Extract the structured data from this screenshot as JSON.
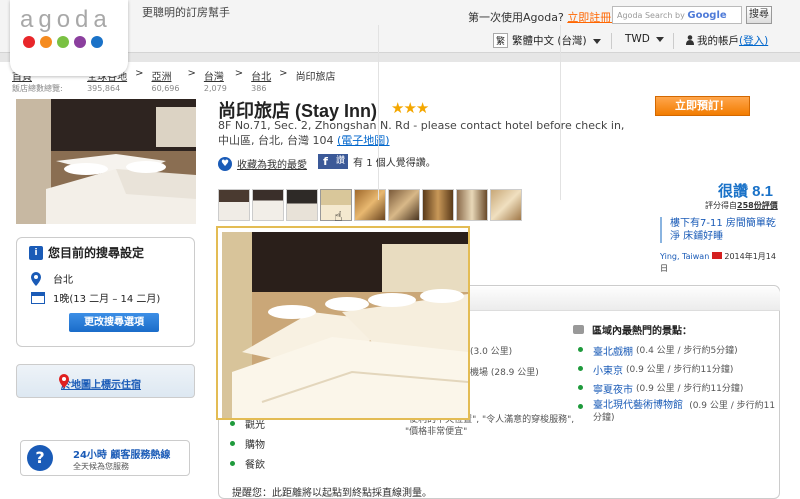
{
  "header": {
    "logo_text": "agoda",
    "logo_colors": [
      "#e8262a",
      "#f58b1f",
      "#7ac143",
      "#8b3f9e",
      "#1a72c8"
    ],
    "tagline": "更聰明的訂房幫手",
    "first_time_text": "第一次使用Agoda?",
    "register_link": "立即註冊!",
    "search_placeholder": "Agoda Search by",
    "search_brand": "Google",
    "search_button": "搜尋",
    "lang_badge": "繁",
    "language": "繁體中文 (台灣)",
    "currency": "TWD",
    "account_label": "我的帳戶",
    "login_link": "(登入)"
  },
  "breadcrumb": [
    {
      "label": "首頁",
      "count": "飯店總數總覽:"
    },
    {
      "label": "全球各地",
      "count": "395,864"
    },
    {
      "label": "亞洲",
      "count": "60,696"
    },
    {
      "label": "台灣",
      "count": "2,079"
    },
    {
      "label": "台北",
      "count": "386"
    }
  ],
  "breadcrumb_current": "尚印旅店",
  "hotel": {
    "name": "尚印旅店 (Stay Inn)",
    "stars": "★★★",
    "address": "8F No.71, Sec. 2, Zhongshan N. Rd - please contact hotel before check in, 中山區, 台北, 台灣 104",
    "map_link": "(電子地圖)",
    "favorite_link": "收藏為我的最愛",
    "fb_like": "讚",
    "fb_text": "有 1 個人覺得讚。",
    "book_button": "立即預訂！"
  },
  "rating": {
    "score_label": "很讚 8.1",
    "sub_prefix": "評分得自",
    "reviews_link": "258份評價",
    "quote": "樓下有7-11 房間簡單乾淨 床鋪好睡",
    "reviewer": "Ying, Taiwan",
    "review_date": "2014年1月14日"
  },
  "search_settings": {
    "title": "您目前的搜尋設定",
    "city": "台北",
    "dates": "1晚(13 二月 – 14 二月)",
    "change_button": "更改搜尋選項"
  },
  "map_link": "於地圖上標示住宿",
  "help": {
    "title": "24小時 顧客服務熱線",
    "subtitle": "全天候為您服務"
  },
  "nearby": {
    "label": "):",
    "rows": [
      {
        "text": "(3.0 公里)"
      },
      {
        "text": "機場 (28.9 公里)"
      }
    ],
    "quote": "\"便利的中央位置\", \"令人滿意的穿梭服務\", \"價格非常便宜\""
  },
  "categories": [
    "觀光",
    "購物",
    "餐飲"
  ],
  "attractions": {
    "title": "區域內最熱門的景點：",
    "items": [
      {
        "name": "臺北戲棚",
        "dist": "(0.4 公里 / 步行約5分鐘)"
      },
      {
        "name": "小東京",
        "dist": "(0.9 公里 / 步行約11分鐘)"
      },
      {
        "name": "寧夏夜市",
        "dist": "(0.9 公里 / 步行約11分鐘)"
      },
      {
        "name": "臺北現代藝術博物館",
        "dist": "(0.9 公里 / 步行約11分鐘)"
      }
    ]
  },
  "note": "提醒您：此距離將以起點到終點採直線測量。"
}
